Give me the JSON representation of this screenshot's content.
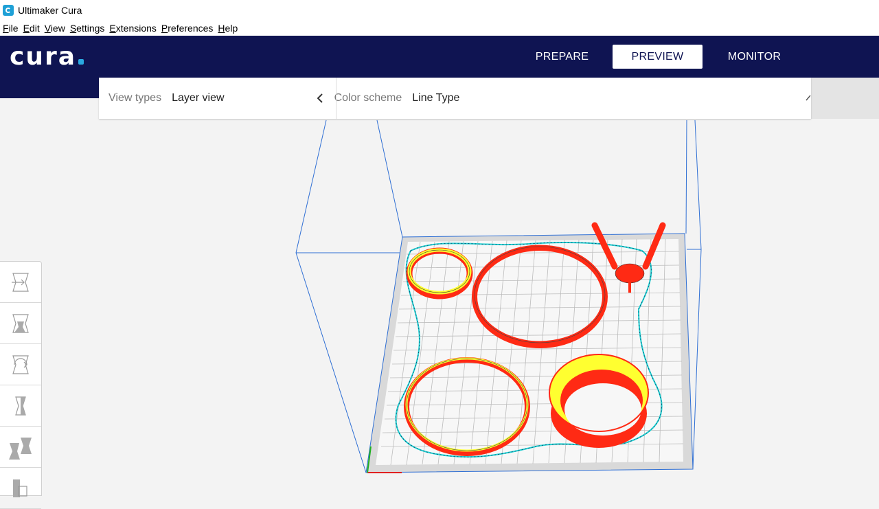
{
  "window": {
    "title": "Ultimaker Cura",
    "icon": "cura-app-icon"
  },
  "menubar": {
    "items": [
      {
        "label": "File",
        "mnemonic": "F",
        "rest": "ile"
      },
      {
        "label": "Edit",
        "mnemonic": "E",
        "rest": "dit"
      },
      {
        "label": "View",
        "mnemonic": "V",
        "rest": "iew"
      },
      {
        "label": "Settings",
        "mnemonic": "S",
        "rest": "ettings"
      },
      {
        "label": "Extensions",
        "mnemonic": "E",
        "rest": "xtensions"
      },
      {
        "label": "Preferences",
        "mnemonic": "P",
        "rest": "references"
      },
      {
        "label": "Help",
        "mnemonic": "H",
        "rest": "elp"
      }
    ]
  },
  "header": {
    "logo": "cura",
    "nav": [
      {
        "label": "PREPARE",
        "active": false
      },
      {
        "label": "PREVIEW",
        "active": true
      },
      {
        "label": "MONITOR",
        "active": false
      }
    ],
    "colors": {
      "bar": "#0f1452",
      "logo_dot": "#2aa9e0"
    }
  },
  "stage": {
    "view_types_label": "View types",
    "view_types_value": "Layer view",
    "color_scheme_label": "Color scheme",
    "color_scheme_value": "Line Type"
  },
  "toolbar": {
    "tools": [
      "move-tool-icon",
      "scale-tool-icon",
      "rotate-tool-icon",
      "mirror-tool-icon",
      "per-model-settings-icon",
      "support-blocker-icon"
    ]
  },
  "scene": {
    "colors": {
      "wall": "#ff2a14",
      "skin": "#ffff30",
      "skirt": "#1fd0d0",
      "volume": "#2f6fd4",
      "plate": "#dadada",
      "grid": "#b8b8b8"
    }
  }
}
